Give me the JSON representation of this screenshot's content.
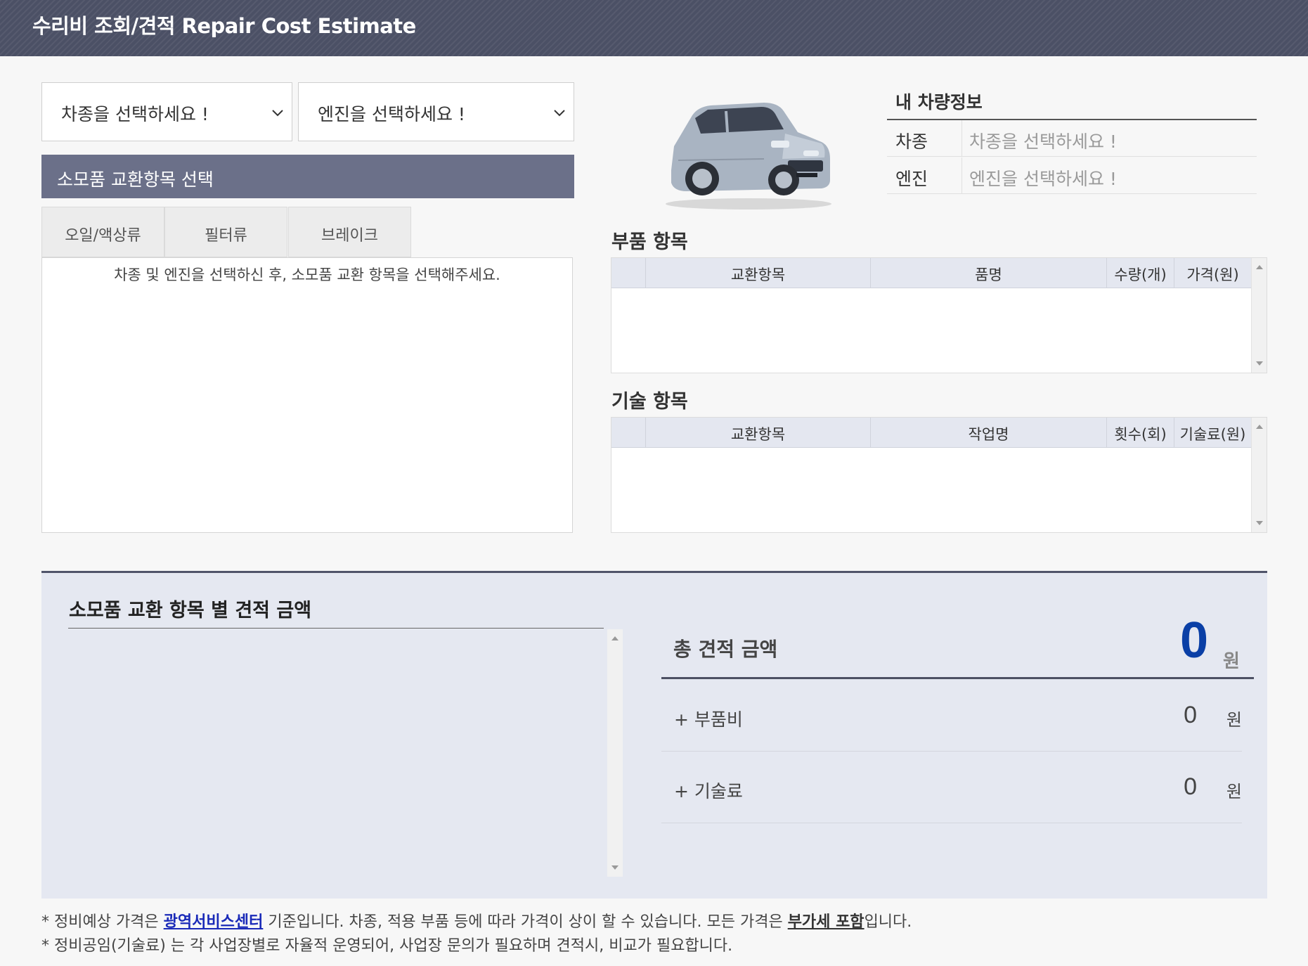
{
  "header": {
    "title": "수리비 조회/견적 Repair Cost Estimate"
  },
  "selectors": {
    "model_placeholder": "차종을 선택하세요 !",
    "engine_placeholder": "엔진을 선택하세요 !"
  },
  "consumables": {
    "title": "소모품 교환항목 선택",
    "tabs": [
      "오일/액상류",
      "필터류",
      "브레이크"
    ],
    "message": "차종 및 엔진을 선택하신 후, 소모품 교환 항목을 선택해주세요."
  },
  "vehicle_info": {
    "title": "내 차량정보",
    "rows": [
      {
        "label": "차종",
        "value": "차종을 선택하세요 !"
      },
      {
        "label": "엔진",
        "value": "엔진을 선택하세요 !"
      }
    ]
  },
  "parts": {
    "title": "부품 항목",
    "columns": [
      "",
      "교환항목",
      "품명",
      "수량(개)",
      "가격(원)"
    ]
  },
  "labor": {
    "title": "기술 항목",
    "columns": [
      "",
      "교환항목",
      "작업명",
      "횟수(회)",
      "기술료(원)"
    ]
  },
  "estimate": {
    "list_title": "소모품 교환 항목 별 견적 금액",
    "total_label": "총 견적 금액",
    "total_value": "0",
    "total_unit": "원",
    "rows": [
      {
        "label": "+ 부품비",
        "value": "0",
        "unit": "원"
      },
      {
        "label": "+ 기술료",
        "value": "0",
        "unit": "원"
      }
    ]
  },
  "notes": {
    "line1_a": "* 정비예상 가격은 ",
    "line1_link": "광역서비스센터",
    "line1_b": " 기준입니다. 차종, 적용 부품 등에 따라 가격이 상이 할 수 있습니다. 모든 가격은 ",
    "line1_bold": "부가세 포함",
    "line1_c": "입니다.",
    "line2": "* 정비공임(기술료) 는 각 사업장별로 자율적 운영되어, 사업장 문의가 필요하며 견적시, 비교가 필요합니다."
  },
  "colors": {
    "header_bg": "#4b5065",
    "section_bar": "#6b7089",
    "total_value": "#0a3fa6",
    "link": "#1a2ab8"
  }
}
